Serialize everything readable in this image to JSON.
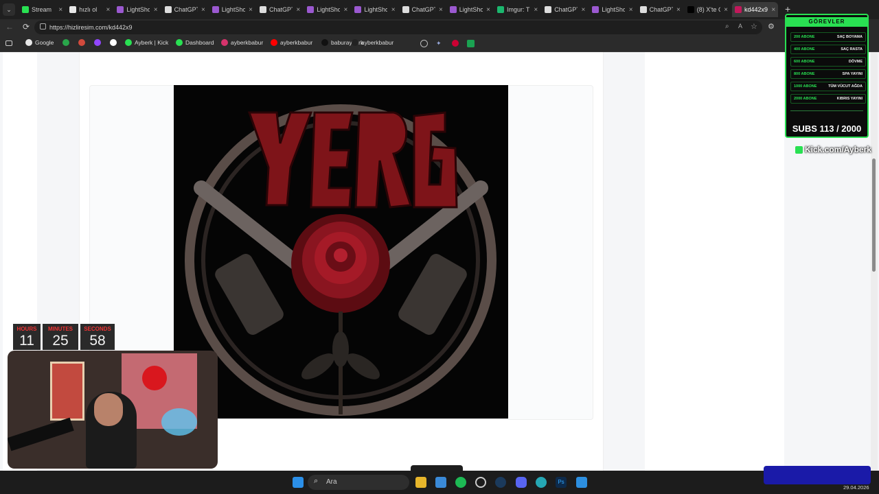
{
  "tabs": [
    {
      "title": "Stream",
      "favicon": "kick-icon"
    },
    {
      "title": "hızlı ol",
      "favicon": "google-icon"
    },
    {
      "title": "LightSho",
      "favicon": "lightshot-icon"
    },
    {
      "title": "ChatGPT",
      "favicon": "chatgpt-icon"
    },
    {
      "title": "LightSho",
      "favicon": "lightshot-icon"
    },
    {
      "title": "ChatGPT",
      "favicon": "chatgpt-icon"
    },
    {
      "title": "LightSho",
      "favicon": "lightshot-icon"
    },
    {
      "title": "LightSho",
      "favicon": "lightshot-icon"
    },
    {
      "title": "ChatGPT",
      "favicon": "chatgpt-icon"
    },
    {
      "title": "LightSho",
      "favicon": "lightshot-icon"
    },
    {
      "title": "Imgur: Th",
      "favicon": "imgur-icon"
    },
    {
      "title": "ChatGPT",
      "favicon": "chatgpt-icon"
    },
    {
      "title": "LightSho",
      "favicon": "lightshot-icon"
    },
    {
      "title": "ChatGPT",
      "favicon": "chatgpt-icon"
    },
    {
      "title": "(8) X'te C",
      "favicon": "x-icon"
    },
    {
      "title": "kd442x9",
      "favicon": "hizliresim-icon",
      "active": true
    }
  ],
  "address": {
    "url": "https://hizliresim.com/kd442x9"
  },
  "bookmarks": [
    {
      "label": "Google",
      "icon": "google-icon"
    },
    {
      "label": "",
      "icon": "green-icon"
    },
    {
      "label": "",
      "icon": "gmail-icon"
    },
    {
      "label": "",
      "icon": "twitch-icon"
    },
    {
      "label": "",
      "icon": "diamond-icon"
    },
    {
      "label": "Ayberk | Kick",
      "icon": "kick-icon"
    },
    {
      "label": "Dashboard",
      "icon": "kick-icon"
    },
    {
      "label": "ayberkbabur",
      "icon": "instagram-icon"
    },
    {
      "label": "ayberkbabur",
      "icon": "youtube-icon"
    },
    {
      "label": "baburayberk",
      "icon": "x-icon"
    },
    {
      "label": "ayberkbabur",
      "icon": "tiktok-icon"
    }
  ],
  "overlay": {
    "title": "GÖREVLER",
    "goals": [
      {
        "amount": "200 ABONE",
        "task": "SAÇ BOYAMA"
      },
      {
        "amount": "400 ABONE",
        "task": "SAÇ RASTA"
      },
      {
        "amount": "600 ABONE",
        "task": "DÖVME"
      },
      {
        "amount": "800 ABONE",
        "task": "SPA YAYINI"
      },
      {
        "amount": "1000 ABONE",
        "task": "TÜM VÜCUT AĞDA"
      },
      {
        "amount": "2000 ABONE",
        "task": "KIBRIS YAYINI"
      }
    ],
    "subs_label": "SUBS 113 / 2000",
    "kick_label": "Kick.com/Ayberk"
  },
  "timer": {
    "hours_label": "HOURS",
    "hours": "11",
    "minutes_label": "MINUTES",
    "minutes": "25",
    "seconds_label": "SECONDS",
    "seconds": "58"
  },
  "taskbar": {
    "search_label": "Ara",
    "date": "29.04.2026"
  },
  "colors": {
    "accent": "#29e052",
    "timer_label": "#e33333",
    "page_bg": "#f5f6f8"
  }
}
